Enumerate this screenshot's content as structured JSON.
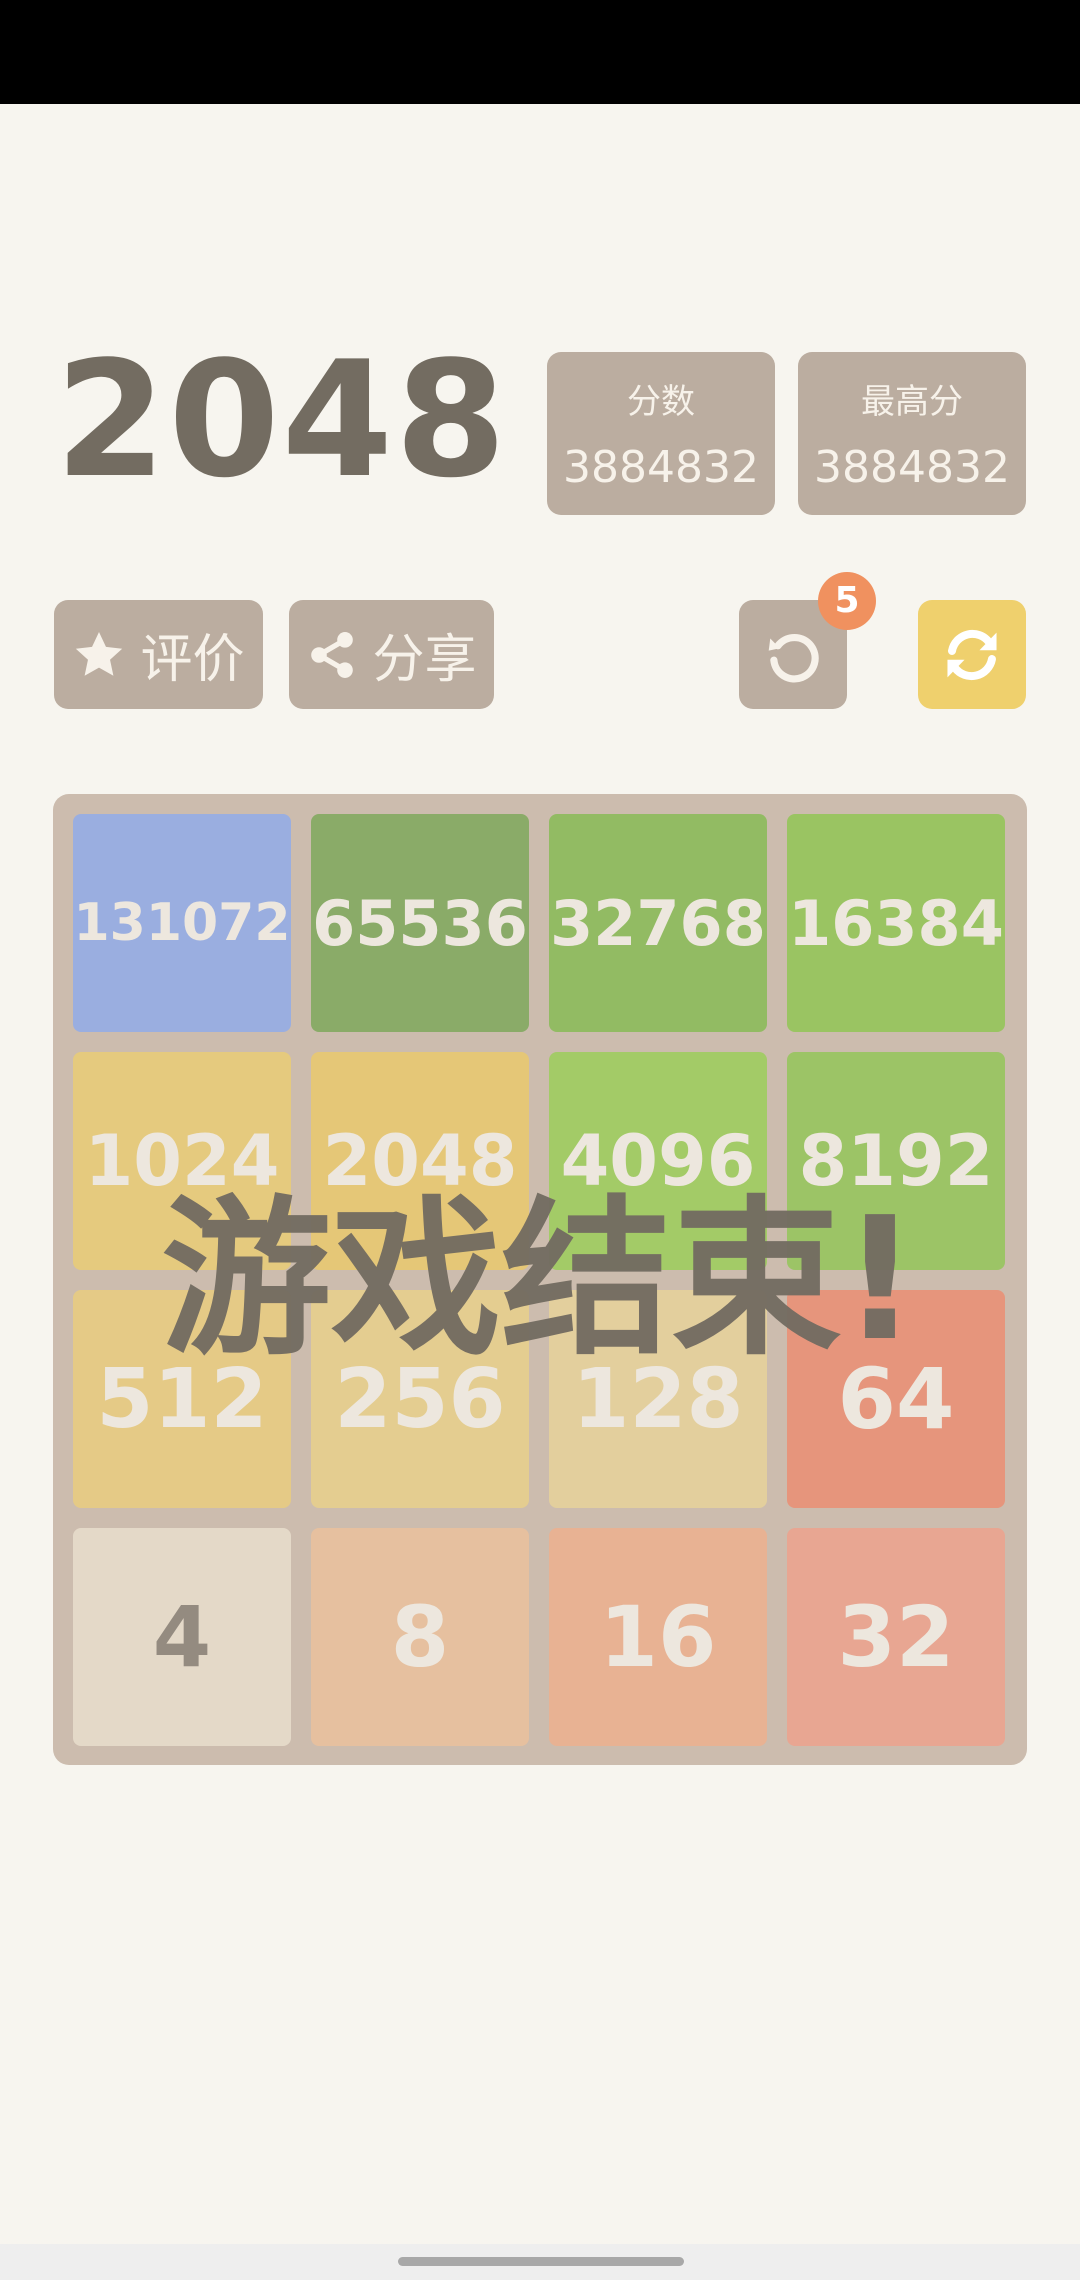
{
  "header": {
    "title": "2048",
    "score_label": "分数",
    "score_value": "3884832",
    "best_label": "最高分",
    "best_value": "3884832"
  },
  "actions": {
    "rate_label": "评价",
    "share_label": "分享",
    "undo_badge": "5"
  },
  "board": {
    "rows": [
      [
        {
          "value": "131072",
          "color": "#9aaee0"
        },
        {
          "value": "65536",
          "color": "#8aab68"
        },
        {
          "value": "32768",
          "color": "#92bb63"
        },
        {
          "value": "16384",
          "color": "#9ac462"
        }
      ],
      [
        {
          "value": "1024",
          "color": "#e5ca7e"
        },
        {
          "value": "2048",
          "color": "#e5c777"
        },
        {
          "value": "4096",
          "color": "#a3cb67"
        },
        {
          "value": "8192",
          "color": "#9cc466"
        }
      ],
      [
        {
          "value": "512",
          "color": "#e5ca86"
        },
        {
          "value": "256",
          "color": "#e4cd90"
        },
        {
          "value": "128",
          "color": "#e3cf9d"
        },
        {
          "value": "64",
          "color": "#e6957c"
        }
      ],
      [
        {
          "value": "4",
          "color": "#e4d9c8"
        },
        {
          "value": "8",
          "color": "#e6c09f"
        },
        {
          "value": "16",
          "color": "#e8b293"
        },
        {
          "value": "32",
          "color": "#e8a692"
        }
      ]
    ]
  },
  "game_over_text": "游戏结束!",
  "colors": {
    "background": "#f7f5ef",
    "button": "#bbada0",
    "restart": "#efd06d",
    "board": "#ccbcae",
    "title": "#736c61"
  },
  "icons": {
    "rate": "star-icon",
    "share": "share-icon",
    "undo": "undo-icon",
    "restart": "restart-icon"
  }
}
